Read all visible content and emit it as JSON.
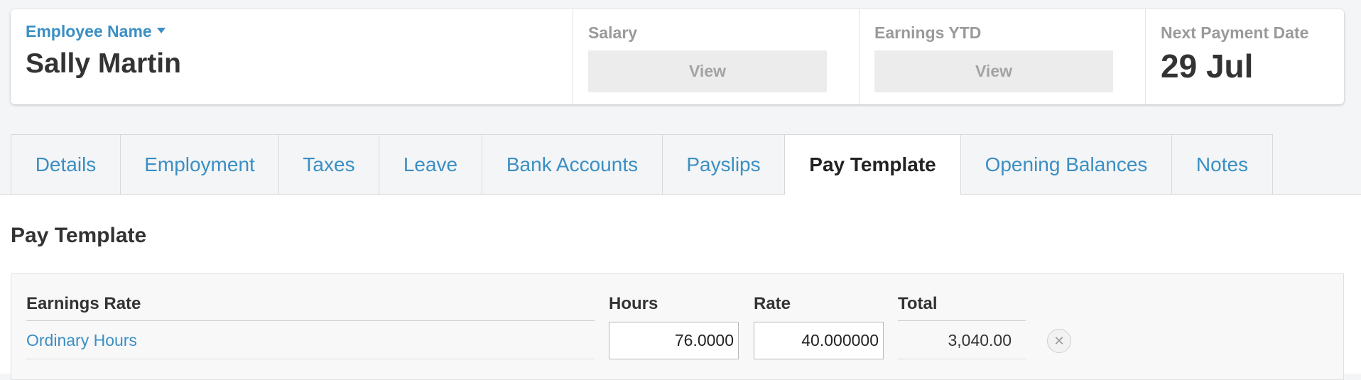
{
  "summary": {
    "employee_label": "Employee Name",
    "employee_name": "Sally Martin",
    "salary_label": "Salary",
    "salary_view": "View",
    "ytd_label": "Earnings YTD",
    "ytd_view": "View",
    "next_payment_label": "Next Payment Date",
    "next_payment_date": "29 Jul"
  },
  "tabs": [
    {
      "label": "Details"
    },
    {
      "label": "Employment"
    },
    {
      "label": "Taxes"
    },
    {
      "label": "Leave"
    },
    {
      "label": "Bank Accounts"
    },
    {
      "label": "Payslips"
    },
    {
      "label": "Pay Template"
    },
    {
      "label": "Opening Balances"
    },
    {
      "label": "Notes"
    }
  ],
  "active_tab": "Pay Template",
  "section": {
    "title": "Pay Template"
  },
  "earnings": {
    "headers": {
      "earnings_rate": "Earnings Rate",
      "hours": "Hours",
      "rate": "Rate",
      "total": "Total"
    },
    "rows": [
      {
        "earnings_rate": "Ordinary Hours",
        "hours": "76.0000",
        "rate": "40.000000",
        "total": "3,040.00"
      }
    ]
  },
  "colors": {
    "link": "#3a8fc4",
    "text": "#333333",
    "muted": "#9a9a9a"
  }
}
